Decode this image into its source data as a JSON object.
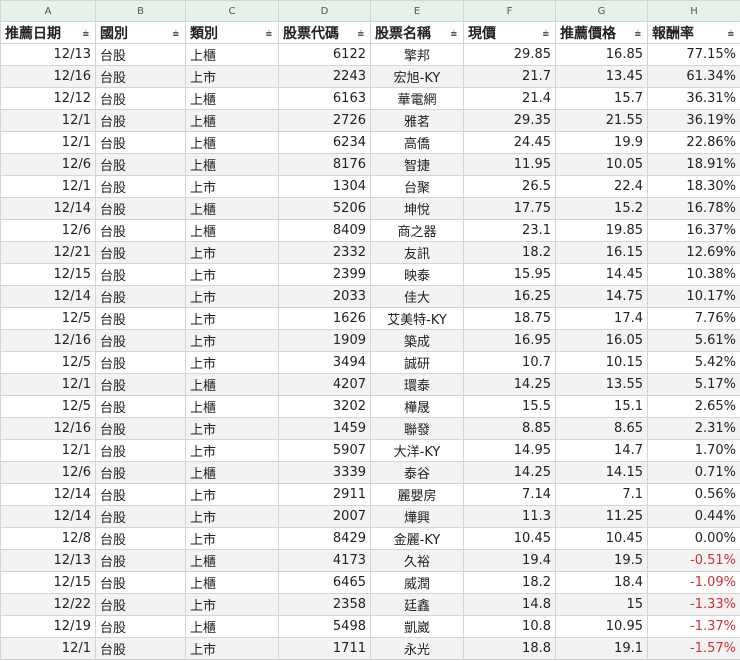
{
  "columns": [
    "A",
    "B",
    "C",
    "D",
    "E",
    "F",
    "G",
    "H"
  ],
  "headers": [
    "推薦日期",
    "國別",
    "類別",
    "股票代碼",
    "股票名稱",
    "現價",
    "推薦價格",
    "報酬率"
  ],
  "filter_icon": "filter-icon",
  "rows": [
    [
      "12/13",
      "台股",
      "上櫃",
      "6122",
      "擎邦",
      "29.85",
      "16.85",
      "77.15%"
    ],
    [
      "12/16",
      "台股",
      "上市",
      "2243",
      "宏旭-KY",
      "21.7",
      "13.45",
      "61.34%"
    ],
    [
      "12/12",
      "台股",
      "上櫃",
      "6163",
      "華電網",
      "21.4",
      "15.7",
      "36.31%"
    ],
    [
      "12/1",
      "台股",
      "上櫃",
      "2726",
      "雅茗",
      "29.35",
      "21.55",
      "36.19%"
    ],
    [
      "12/1",
      "台股",
      "上櫃",
      "6234",
      "高僑",
      "24.45",
      "19.9",
      "22.86%"
    ],
    [
      "12/6",
      "台股",
      "上櫃",
      "8176",
      "智捷",
      "11.95",
      "10.05",
      "18.91%"
    ],
    [
      "12/1",
      "台股",
      "上市",
      "1304",
      "台聚",
      "26.5",
      "22.4",
      "18.30%"
    ],
    [
      "12/14",
      "台股",
      "上櫃",
      "5206",
      "坤悅",
      "17.75",
      "15.2",
      "16.78%"
    ],
    [
      "12/6",
      "台股",
      "上櫃",
      "8409",
      "商之器",
      "23.1",
      "19.85",
      "16.37%"
    ],
    [
      "12/21",
      "台股",
      "上市",
      "2332",
      "友訊",
      "18.2",
      "16.15",
      "12.69%"
    ],
    [
      "12/15",
      "台股",
      "上市",
      "2399",
      "映泰",
      "15.95",
      "14.45",
      "10.38%"
    ],
    [
      "12/14",
      "台股",
      "上市",
      "2033",
      "佳大",
      "16.25",
      "14.75",
      "10.17%"
    ],
    [
      "12/5",
      "台股",
      "上市",
      "1626",
      "艾美特-KY",
      "18.75",
      "17.4",
      "7.76%"
    ],
    [
      "12/16",
      "台股",
      "上市",
      "1909",
      "築成",
      "16.95",
      "16.05",
      "5.61%"
    ],
    [
      "12/5",
      "台股",
      "上市",
      "3494",
      "誠研",
      "10.7",
      "10.15",
      "5.42%"
    ],
    [
      "12/1",
      "台股",
      "上櫃",
      "4207",
      "環泰",
      "14.25",
      "13.55",
      "5.17%"
    ],
    [
      "12/5",
      "台股",
      "上櫃",
      "3202",
      "樺晟",
      "15.5",
      "15.1",
      "2.65%"
    ],
    [
      "12/16",
      "台股",
      "上市",
      "1459",
      "聯發",
      "8.85",
      "8.65",
      "2.31%"
    ],
    [
      "12/1",
      "台股",
      "上市",
      "5907",
      "大洋-KY",
      "14.95",
      "14.7",
      "1.70%"
    ],
    [
      "12/6",
      "台股",
      "上櫃",
      "3339",
      "泰谷",
      "14.25",
      "14.15",
      "0.71%"
    ],
    [
      "12/14",
      "台股",
      "上市",
      "2911",
      "麗嬰房",
      "7.14",
      "7.1",
      "0.56%"
    ],
    [
      "12/14",
      "台股",
      "上市",
      "2007",
      "燁興",
      "11.3",
      "11.25",
      "0.44%"
    ],
    [
      "12/8",
      "台股",
      "上市",
      "8429",
      "金麗-KY",
      "10.45",
      "10.45",
      "0.00%"
    ],
    [
      "12/13",
      "台股",
      "上櫃",
      "4173",
      "久裕",
      "19.4",
      "19.5",
      "-0.51%"
    ],
    [
      "12/15",
      "台股",
      "上櫃",
      "6465",
      "威潤",
      "18.2",
      "18.4",
      "-1.09%"
    ],
    [
      "12/22",
      "台股",
      "上市",
      "2358",
      "廷鑫",
      "14.8",
      "15",
      "-1.33%"
    ],
    [
      "12/19",
      "台股",
      "上櫃",
      "5498",
      "凱崴",
      "10.8",
      "10.95",
      "-1.37%"
    ],
    [
      "12/1",
      "台股",
      "上市",
      "1711",
      "永光",
      "18.8",
      "19.1",
      "-1.57%"
    ]
  ]
}
